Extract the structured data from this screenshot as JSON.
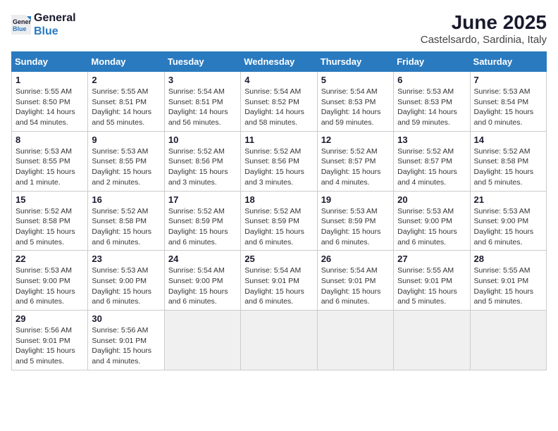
{
  "logo": {
    "line1": "General",
    "line2": "Blue"
  },
  "title": "June 2025",
  "location": "Castelsardo, Sardinia, Italy",
  "weekdays": [
    "Sunday",
    "Monday",
    "Tuesday",
    "Wednesday",
    "Thursday",
    "Friday",
    "Saturday"
  ],
  "weeks": [
    [
      {
        "day": "1",
        "info": "Sunrise: 5:55 AM\nSunset: 8:50 PM\nDaylight: 14 hours\nand 54 minutes."
      },
      {
        "day": "2",
        "info": "Sunrise: 5:55 AM\nSunset: 8:51 PM\nDaylight: 14 hours\nand 55 minutes."
      },
      {
        "day": "3",
        "info": "Sunrise: 5:54 AM\nSunset: 8:51 PM\nDaylight: 14 hours\nand 56 minutes."
      },
      {
        "day": "4",
        "info": "Sunrise: 5:54 AM\nSunset: 8:52 PM\nDaylight: 14 hours\nand 58 minutes."
      },
      {
        "day": "5",
        "info": "Sunrise: 5:54 AM\nSunset: 8:53 PM\nDaylight: 14 hours\nand 59 minutes."
      },
      {
        "day": "6",
        "info": "Sunrise: 5:53 AM\nSunset: 8:53 PM\nDaylight: 14 hours\nand 59 minutes."
      },
      {
        "day": "7",
        "info": "Sunrise: 5:53 AM\nSunset: 8:54 PM\nDaylight: 15 hours\nand 0 minutes."
      }
    ],
    [
      {
        "day": "8",
        "info": "Sunrise: 5:53 AM\nSunset: 8:55 PM\nDaylight: 15 hours\nand 1 minute."
      },
      {
        "day": "9",
        "info": "Sunrise: 5:53 AM\nSunset: 8:55 PM\nDaylight: 15 hours\nand 2 minutes."
      },
      {
        "day": "10",
        "info": "Sunrise: 5:52 AM\nSunset: 8:56 PM\nDaylight: 15 hours\nand 3 minutes."
      },
      {
        "day": "11",
        "info": "Sunrise: 5:52 AM\nSunset: 8:56 PM\nDaylight: 15 hours\nand 3 minutes."
      },
      {
        "day": "12",
        "info": "Sunrise: 5:52 AM\nSunset: 8:57 PM\nDaylight: 15 hours\nand 4 minutes."
      },
      {
        "day": "13",
        "info": "Sunrise: 5:52 AM\nSunset: 8:57 PM\nDaylight: 15 hours\nand 4 minutes."
      },
      {
        "day": "14",
        "info": "Sunrise: 5:52 AM\nSunset: 8:58 PM\nDaylight: 15 hours\nand 5 minutes."
      }
    ],
    [
      {
        "day": "15",
        "info": "Sunrise: 5:52 AM\nSunset: 8:58 PM\nDaylight: 15 hours\nand 5 minutes."
      },
      {
        "day": "16",
        "info": "Sunrise: 5:52 AM\nSunset: 8:58 PM\nDaylight: 15 hours\nand 6 minutes."
      },
      {
        "day": "17",
        "info": "Sunrise: 5:52 AM\nSunset: 8:59 PM\nDaylight: 15 hours\nand 6 minutes."
      },
      {
        "day": "18",
        "info": "Sunrise: 5:52 AM\nSunset: 8:59 PM\nDaylight: 15 hours\nand 6 minutes."
      },
      {
        "day": "19",
        "info": "Sunrise: 5:53 AM\nSunset: 8:59 PM\nDaylight: 15 hours\nand 6 minutes."
      },
      {
        "day": "20",
        "info": "Sunrise: 5:53 AM\nSunset: 9:00 PM\nDaylight: 15 hours\nand 6 minutes."
      },
      {
        "day": "21",
        "info": "Sunrise: 5:53 AM\nSunset: 9:00 PM\nDaylight: 15 hours\nand 6 minutes."
      }
    ],
    [
      {
        "day": "22",
        "info": "Sunrise: 5:53 AM\nSunset: 9:00 PM\nDaylight: 15 hours\nand 6 minutes."
      },
      {
        "day": "23",
        "info": "Sunrise: 5:53 AM\nSunset: 9:00 PM\nDaylight: 15 hours\nand 6 minutes."
      },
      {
        "day": "24",
        "info": "Sunrise: 5:54 AM\nSunset: 9:00 PM\nDaylight: 15 hours\nand 6 minutes."
      },
      {
        "day": "25",
        "info": "Sunrise: 5:54 AM\nSunset: 9:01 PM\nDaylight: 15 hours\nand 6 minutes."
      },
      {
        "day": "26",
        "info": "Sunrise: 5:54 AM\nSunset: 9:01 PM\nDaylight: 15 hours\nand 6 minutes."
      },
      {
        "day": "27",
        "info": "Sunrise: 5:55 AM\nSunset: 9:01 PM\nDaylight: 15 hours\nand 5 minutes."
      },
      {
        "day": "28",
        "info": "Sunrise: 5:55 AM\nSunset: 9:01 PM\nDaylight: 15 hours\nand 5 minutes."
      }
    ],
    [
      {
        "day": "29",
        "info": "Sunrise: 5:56 AM\nSunset: 9:01 PM\nDaylight: 15 hours\nand 5 minutes."
      },
      {
        "day": "30",
        "info": "Sunrise: 5:56 AM\nSunset: 9:01 PM\nDaylight: 15 hours\nand 4 minutes."
      },
      {
        "day": "",
        "info": ""
      },
      {
        "day": "",
        "info": ""
      },
      {
        "day": "",
        "info": ""
      },
      {
        "day": "",
        "info": ""
      },
      {
        "day": "",
        "info": ""
      }
    ]
  ]
}
